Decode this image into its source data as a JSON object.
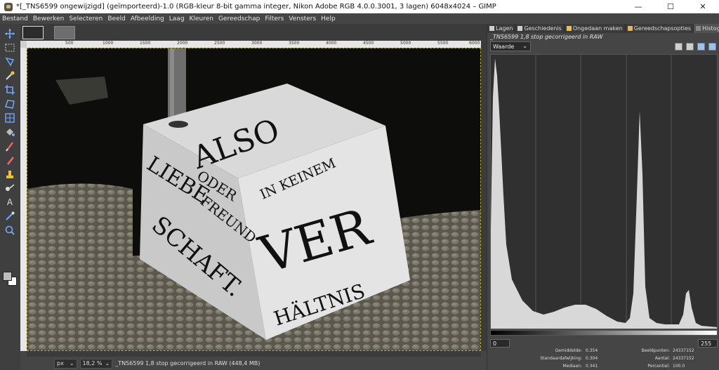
{
  "window": {
    "title": "*[_TNS6599 ongewijzigd] (geïmporteerd)-1.0 (RGB-kleur 8-bit gamma integer, Nikon Adobe RGB 4.0.0.3001, 3 lagen) 6048x4024 – GIMP",
    "minimize": "—",
    "maximize": "☐",
    "close": "✕"
  },
  "menu": [
    "Bestand",
    "Bewerken",
    "Selecteren",
    "Beeld",
    "Afbeelding",
    "Laag",
    "Kleuren",
    "Gereedschap",
    "Filters",
    "Vensters",
    "Help"
  ],
  "image_tabs": {
    "close": "⊗"
  },
  "ruler": {
    "labels": [
      "500",
      "1000",
      "1500",
      "2000",
      "2500",
      "3000",
      "3500",
      "4000",
      "4500",
      "5000",
      "5500",
      "6000"
    ]
  },
  "status": {
    "unit": "px",
    "zoom": "18,2 %",
    "message": "_TNS6599 1,8 stop gecorrigeerd in RAW (448,4 MB)"
  },
  "dock": {
    "tabs": [
      {
        "label": "Lagen",
        "icon": "layers-icon"
      },
      {
        "label": "Geschiedenis",
        "icon": "history-icon"
      },
      {
        "label": "Ongedaan maken",
        "icon": "undo-icon"
      },
      {
        "label": "Gereedschapsopties",
        "icon": "tool-options-icon"
      },
      {
        "label": "Histogram",
        "icon": "histogram-icon"
      }
    ],
    "layer_name": "_TNS6599 1,8 stop gecorrigeerd in RAW",
    "channel": "Waarde",
    "range_start": "0",
    "range_end": "255"
  },
  "stats": {
    "mean_label": "Gemiddelde:",
    "mean": "0.354",
    "stddev_label": "Standaardafwijking:",
    "stddev": "0.304",
    "median_label": "Mediaan:",
    "median": "0.341",
    "pixels_label": "Beeldpunten:",
    "pixels": "24337152",
    "count_label": "Aantal:",
    "count": "24337152",
    "percentile_label": "Percentiel:",
    "percentile": "100.0"
  },
  "artwork": {
    "words_left": [
      "LIEBE",
      "ODER",
      "FREUND",
      "SCHAFT."
    ],
    "words_right": [
      "IN KEINEM",
      "VER",
      "HÄLTNIS"
    ],
    "word_top": "ALSO"
  },
  "colors": {
    "accent": "#b5a92c",
    "panel": "#454545",
    "canvas_border": "#b5a92c"
  }
}
